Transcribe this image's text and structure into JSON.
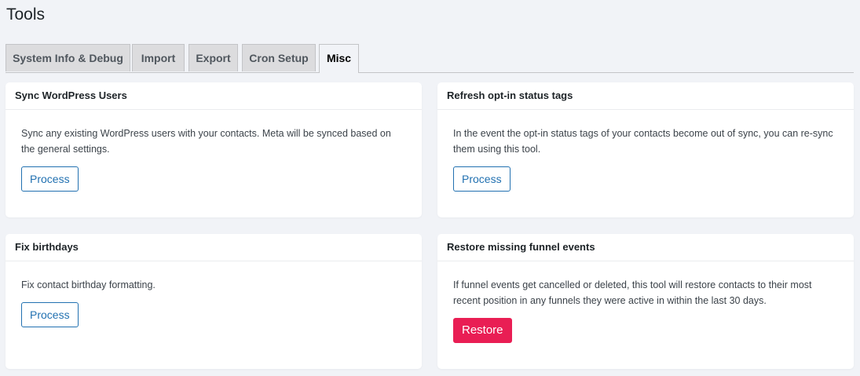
{
  "page": {
    "title": "Tools"
  },
  "tabs": [
    {
      "label": "System Info & Debug"
    },
    {
      "label": "Import"
    },
    {
      "label": "Export"
    },
    {
      "label": "Cron Setup"
    },
    {
      "label": "Misc"
    }
  ],
  "cards": [
    {
      "title": "Sync WordPress Users",
      "description": "Sync any existing WordPress users with your contacts. Meta will be synced based on the general settings.",
      "button": "Process"
    },
    {
      "title": "Refresh opt-in status tags",
      "description": "In the event the opt-in status tags of your contacts become out of sync, you can re-sync them using this tool.",
      "button": "Process"
    },
    {
      "title": "Fix birthdays",
      "description": "Fix contact birthday formatting.",
      "button": "Process"
    },
    {
      "title": "Restore missing funnel events",
      "description": "If funnel events get cancelled or deleted, this tool will restore contacts to their most recent position in any funnels they were active in within the last 30 days.",
      "button": "Restore"
    }
  ],
  "colors": {
    "background": "#f1f3f7",
    "primary": "#2271b1",
    "danger": "#e91e54"
  }
}
